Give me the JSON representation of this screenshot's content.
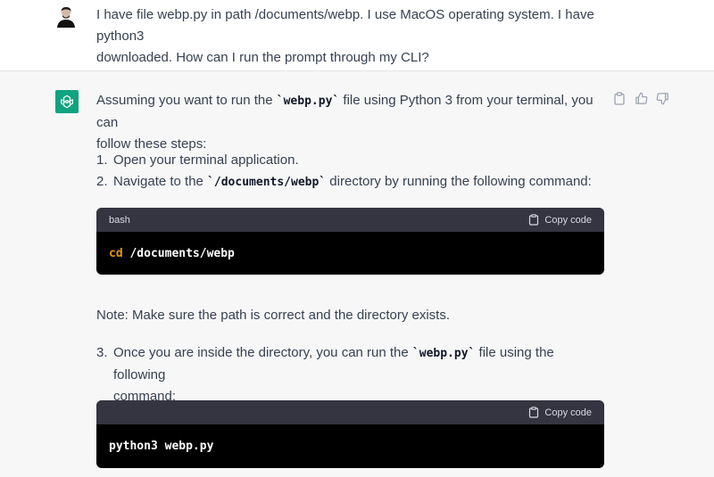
{
  "user_message": {
    "line1": "I have file webp.py in path /documents/webp. I use MacOS operating system. I have python3",
    "line2": "downloaded. How can I run the prompt through my CLI?"
  },
  "assistant": {
    "intro_pre": "Assuming you want to run the ",
    "intro_code": "`webp.py`",
    "intro_post": " file using Python 3 from your terminal, you can",
    "intro_line2": "follow these steps:",
    "steps": [
      {
        "num": "1.",
        "pre": "Open your terminal application.",
        "code": "",
        "post": ""
      },
      {
        "num": "2.",
        "pre": "Navigate to the ",
        "code": "`/documents/webp`",
        "post": " directory by running the following command:"
      },
      {
        "num": "3.",
        "pre": "Once you are inside the directory, you can run the ",
        "code": "`webp.py`",
        "post": " file using the following",
        "line2": "command:"
      }
    ],
    "note": "Note: Make sure the path is correct and the directory exists.",
    "code_block_1": {
      "lang": "bash",
      "copy_label": "Copy code",
      "keyword": "cd",
      "rest": " /documents/webp"
    },
    "code_block_2": {
      "lang": "",
      "copy_label": "Copy code",
      "text": "python3 webp.py"
    }
  },
  "icons": [
    "clipboard-icon",
    "thumbs-up-icon",
    "thumbs-down-icon",
    "copy-icon",
    "openai-logo-icon",
    "user-avatar"
  ],
  "colors": {
    "brand": "#10a37f",
    "code_header": "#343541",
    "code_bg": "#000000",
    "keyword": "#e9950c",
    "assistant_bg": "#f7f7f8"
  }
}
